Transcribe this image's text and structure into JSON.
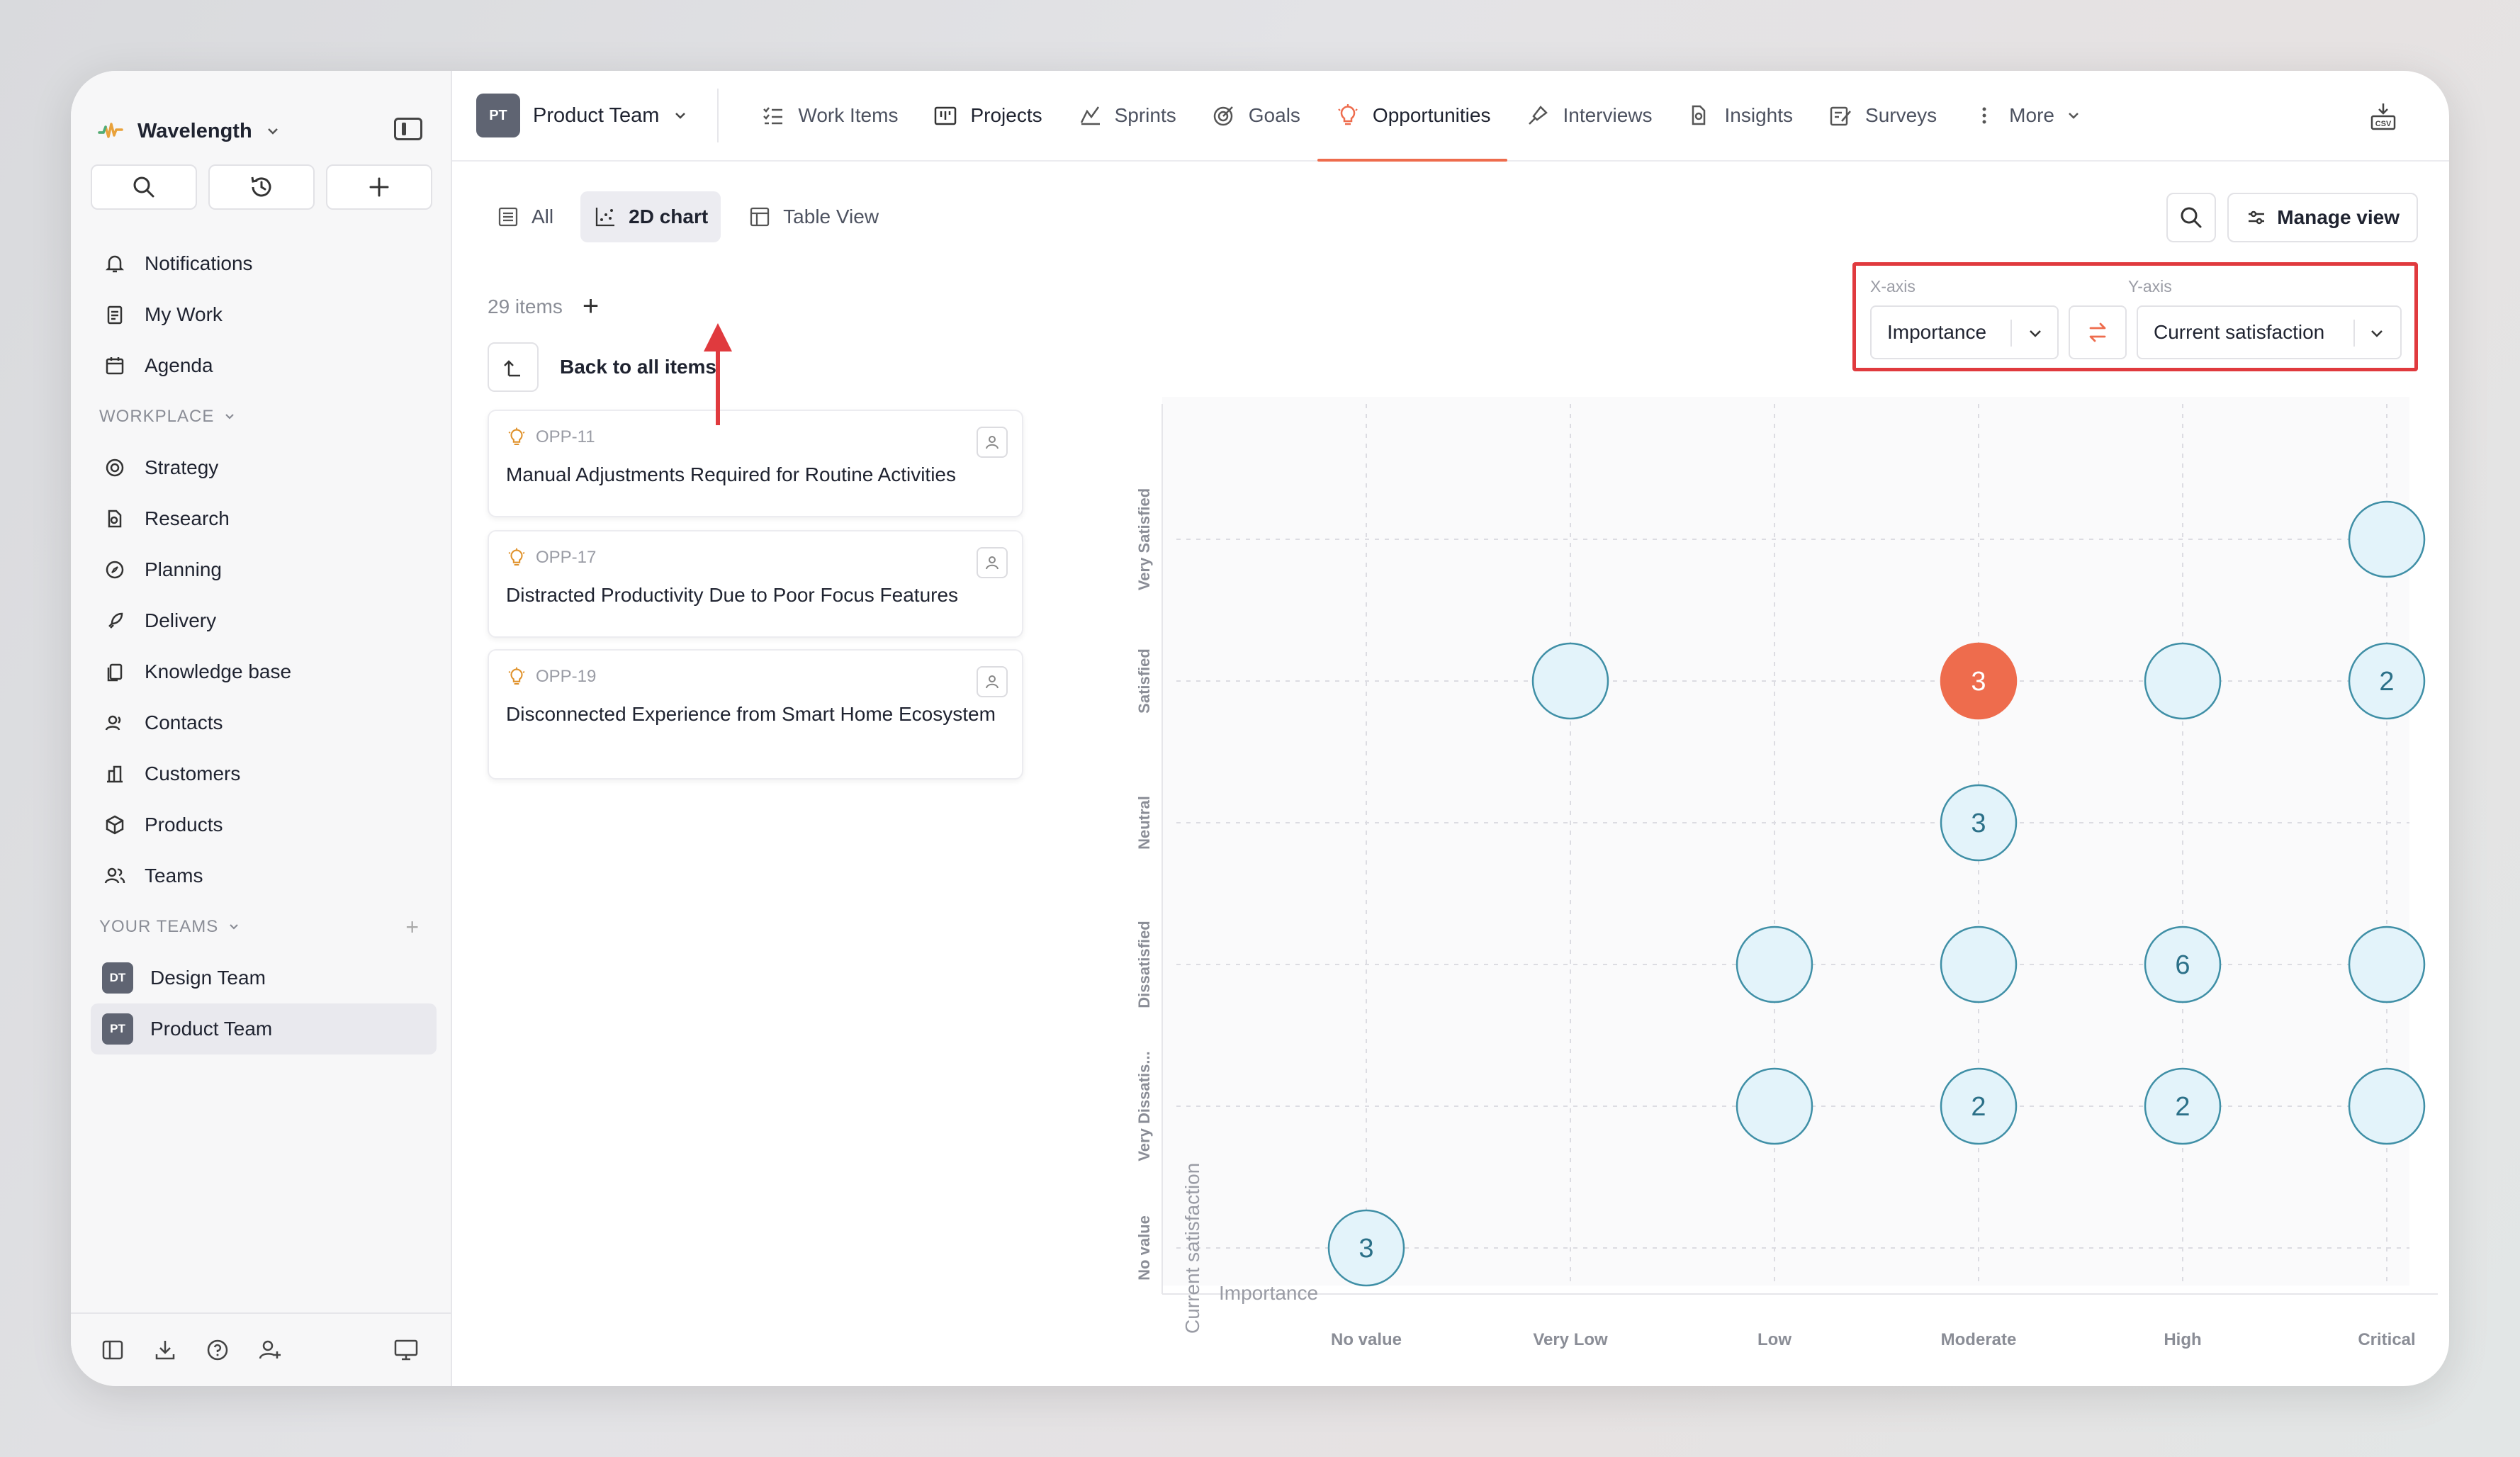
{
  "workspace": {
    "name": "Wavelength"
  },
  "sidebar": {
    "top_items": [
      {
        "label": "Notifications",
        "icon": "bell-icon"
      },
      {
        "label": "My Work",
        "icon": "clipboard-icon"
      },
      {
        "label": "Agenda",
        "icon": "calendar-icon"
      }
    ],
    "workplace_label": "WORKPLACE",
    "workplace_items": [
      {
        "label": "Strategy",
        "icon": "target-icon"
      },
      {
        "label": "Research",
        "icon": "research-icon"
      },
      {
        "label": "Planning",
        "icon": "compass-icon"
      },
      {
        "label": "Delivery",
        "icon": "rocket-icon"
      },
      {
        "label": "Knowledge base",
        "icon": "book-icon"
      },
      {
        "label": "Contacts",
        "icon": "contacts-icon"
      },
      {
        "label": "Customers",
        "icon": "building-icon"
      },
      {
        "label": "Products",
        "icon": "cube-icon"
      },
      {
        "label": "Teams",
        "icon": "users-icon"
      }
    ],
    "teams_label": "YOUR TEAMS",
    "teams": [
      {
        "badge": "DT",
        "label": "Design Team",
        "active": false
      },
      {
        "badge": "PT",
        "label": "Product Team",
        "active": true
      }
    ]
  },
  "topbar": {
    "team_badge": "PT",
    "team_name": "Product Team",
    "tabs": [
      {
        "label": "Work Items",
        "icon": "list-check-icon"
      },
      {
        "label": "Projects",
        "icon": "projects-icon"
      },
      {
        "label": "Sprints",
        "icon": "sprint-icon"
      },
      {
        "label": "Goals",
        "icon": "goal-icon"
      },
      {
        "label": "Opportunities",
        "icon": "lightbulb-icon",
        "active": true
      },
      {
        "label": "Interviews",
        "icon": "microphone-icon"
      },
      {
        "label": "Insights",
        "icon": "insights-icon"
      },
      {
        "label": "Surveys",
        "icon": "survey-icon"
      },
      {
        "label": "More",
        "icon": "more-vertical-icon"
      }
    ]
  },
  "views": {
    "all": "All",
    "chart": "2D chart",
    "table": "Table View",
    "manage": "Manage view"
  },
  "items_panel": {
    "count": "29 items",
    "back": "Back to all items",
    "cards": [
      {
        "id": "OPP-11",
        "title": "Manual Adjustments Required for Routine Activities"
      },
      {
        "id": "OPP-17",
        "title": "Distracted Productivity Due to Poor Focus Features"
      },
      {
        "id": "OPP-19",
        "title": "Disconnected Experience from Smart Home Ecosystem"
      }
    ]
  },
  "axes": {
    "x_label": "X-axis",
    "x_value": "Importance",
    "y_label": "Y-axis",
    "y_value": "Current satisfaction"
  },
  "colors": {
    "accent": "#ee6c4d",
    "bubble_fill": "#e3f3fa",
    "bubble_stroke": "#3f8fa6",
    "bubble_text": "#2b7088",
    "highlight": "#e03a3e"
  },
  "chart_data": {
    "type": "scatter",
    "x_title": "Importance",
    "y_title": "Current satisfaction",
    "x_categories": [
      "No value",
      "Very Low",
      "Low",
      "Moderate",
      "High",
      "Critical"
    ],
    "y_categories": [
      "No value",
      "Very Dissatis...",
      "Dissatisfied",
      "Neutral",
      "Satisfied",
      "Very Satisfied"
    ],
    "points": [
      {
        "x": "Critical",
        "y": "Very Satisfied",
        "count": 1,
        "label": ""
      },
      {
        "x": "Very Low",
        "y": "Satisfied",
        "count": 1,
        "label": ""
      },
      {
        "x": "Moderate",
        "y": "Satisfied",
        "count": 3,
        "label": "3",
        "selected": true
      },
      {
        "x": "High",
        "y": "Satisfied",
        "count": 1,
        "label": ""
      },
      {
        "x": "Critical",
        "y": "Satisfied",
        "count": 2,
        "label": "2"
      },
      {
        "x": "Moderate",
        "y": "Neutral",
        "count": 3,
        "label": "3"
      },
      {
        "x": "Low",
        "y": "Dissatisfied",
        "count": 1,
        "label": ""
      },
      {
        "x": "Moderate",
        "y": "Dissatisfied",
        "count": 1,
        "label": ""
      },
      {
        "x": "High",
        "y": "Dissatisfied",
        "count": 6,
        "label": "6"
      },
      {
        "x": "Critical",
        "y": "Dissatisfied",
        "count": 1,
        "label": ""
      },
      {
        "x": "Low",
        "y": "Very Dissatis...",
        "count": 1,
        "label": ""
      },
      {
        "x": "Moderate",
        "y": "Very Dissatis...",
        "count": 2,
        "label": "2"
      },
      {
        "x": "High",
        "y": "Very Dissatis...",
        "count": 2,
        "label": "2"
      },
      {
        "x": "Critical",
        "y": "Very Dissatis...",
        "count": 1,
        "label": ""
      },
      {
        "x": "No value",
        "y": "No value",
        "count": 3,
        "label": "3"
      }
    ],
    "grid": true
  }
}
